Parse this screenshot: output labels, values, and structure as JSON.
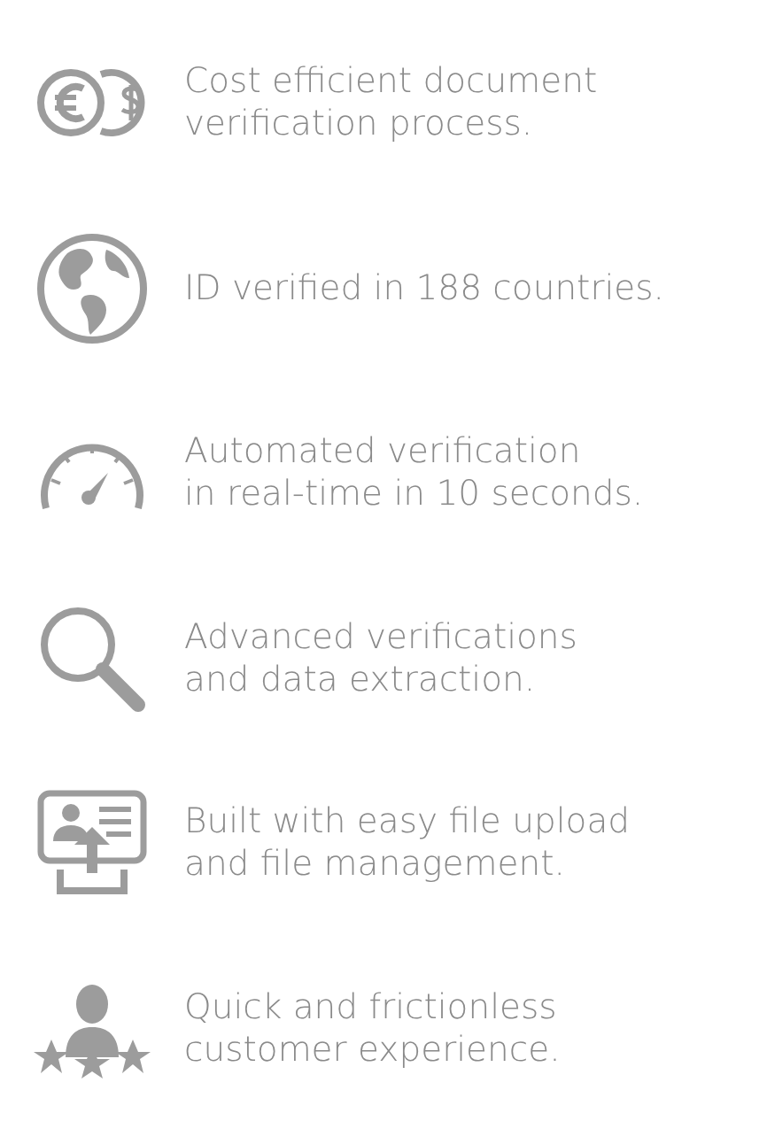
{
  "features": [
    {
      "kind": "money",
      "lines": [
        "Cost efficient document",
        "verification process."
      ]
    },
    {
      "kind": "globe",
      "lines": [
        "ID verified in 188 countries."
      ]
    },
    {
      "kind": "gauge",
      "lines": [
        "Automated verification",
        "in real-time in 10 seconds."
      ]
    },
    {
      "kind": "search",
      "lines": [
        "Advanced verifications",
        "and data extraction."
      ]
    },
    {
      "kind": "upload",
      "lines": [
        "Built with easy file upload",
        "and file management."
      ]
    },
    {
      "kind": "rating",
      "lines": [
        "Quick and frictionless",
        "customer experience."
      ]
    }
  ]
}
